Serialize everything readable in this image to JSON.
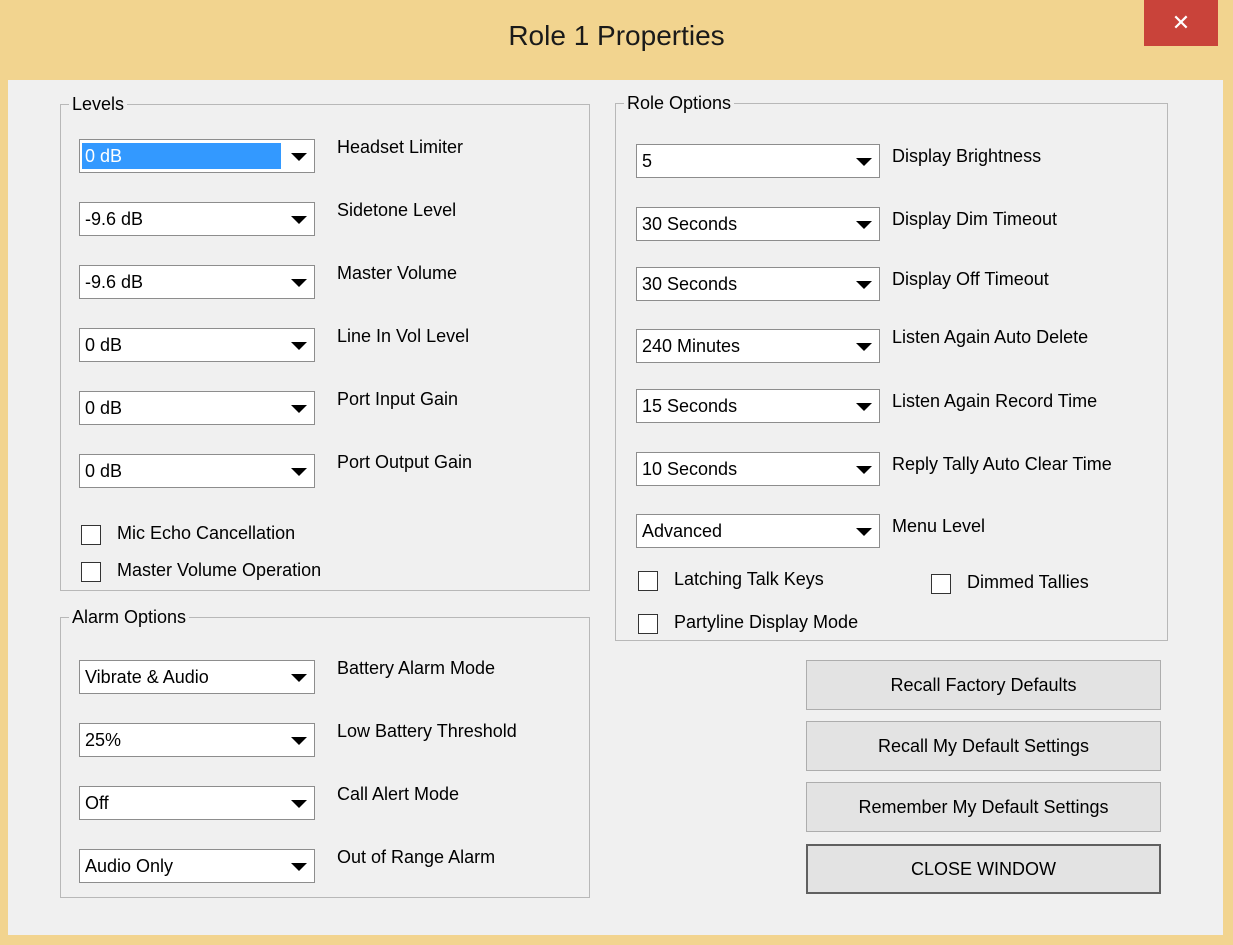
{
  "window": {
    "title": "Role 1 Properties",
    "close_glyph": "✕"
  },
  "levels": {
    "legend": "Levels",
    "rows": [
      {
        "value": "0 dB",
        "label": "Headset Limiter"
      },
      {
        "value": "-9.6 dB",
        "label": "Sidetone Level"
      },
      {
        "value": "-9.6 dB",
        "label": "Master Volume"
      },
      {
        "value": "0 dB",
        "label": "Line In Vol Level"
      },
      {
        "value": "0 dB",
        "label": "Port Input Gain"
      },
      {
        "value": "0 dB",
        "label": "Port Output Gain"
      }
    ],
    "checkboxes": [
      {
        "label": "Mic Echo Cancellation",
        "checked": false
      },
      {
        "label": "Master Volume Operation",
        "checked": false
      }
    ]
  },
  "alarm": {
    "legend": "Alarm Options",
    "rows": [
      {
        "value": "Vibrate & Audio",
        "label": "Battery Alarm Mode"
      },
      {
        "value": "25%",
        "label": "Low Battery Threshold"
      },
      {
        "value": "Off",
        "label": "Call Alert Mode"
      },
      {
        "value": "Audio Only",
        "label": "Out of Range Alarm"
      }
    ]
  },
  "role": {
    "legend": "Role Options",
    "rows": [
      {
        "value": "5",
        "label": "Display Brightness"
      },
      {
        "value": "30 Seconds",
        "label": "Display Dim Timeout"
      },
      {
        "value": "30 Seconds",
        "label": "Display Off Timeout"
      },
      {
        "value": "240 Minutes",
        "label": "Listen Again Auto Delete"
      },
      {
        "value": "15 Seconds",
        "label": "Listen Again Record Time"
      },
      {
        "value": "10 Seconds",
        "label": "Reply Tally Auto Clear Time"
      },
      {
        "value": "Advanced",
        "label": "Menu Level"
      }
    ],
    "checkboxes": [
      {
        "label": "Latching Talk Keys",
        "checked": false
      },
      {
        "label": "Dimmed Tallies",
        "checked": false
      },
      {
        "label": "Partyline Display Mode",
        "checked": false
      }
    ]
  },
  "buttons": {
    "recall_factory": "Recall Factory Defaults",
    "recall_mine": "Recall My Default Settings",
    "remember_mine": "Remember My Default Settings",
    "close_window": "CLOSE WINDOW"
  },
  "colors": {
    "title_bar": "#f2d48f",
    "close_button": "#c9433a",
    "client_bg": "#f0f0f0",
    "selection": "#3399ff"
  }
}
